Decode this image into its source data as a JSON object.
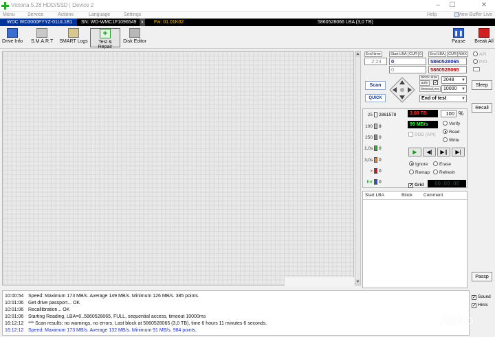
{
  "window": {
    "title": "Victoria 5.28 HDD/SSD | Device 2",
    "controls": [
      "–",
      "☐",
      "✕"
    ]
  },
  "menu": {
    "items": [
      "Menu",
      "Service",
      "Actions",
      "Language",
      "Settings",
      "Help"
    ],
    "view_buffer": "View Buffer Live"
  },
  "drive": {
    "model": "WDC WD3000FYYZ-01UL1B1",
    "serial": "SN: WD-WMC1F1096549",
    "close": "x",
    "firmware": "Fw: 01.01K02",
    "lba": "5860528066 LBA (3,0 TB)"
  },
  "toolbar": {
    "buttons": [
      "Drive Info",
      "S.M.A.R.T",
      "SMART Logs",
      "Test & Repair",
      "Disk Editor"
    ],
    "pause": "Pause",
    "break_all": "Break All"
  },
  "range": {
    "end_time_label": "End time",
    "start_lba_label": "Start LBA",
    "cur_label": "CUR",
    "zero_label": "0",
    "end_lba_label": "End LBA",
    "max_label": "MAX",
    "end_time": "2:24",
    "start_lba": "0",
    "start_lba_cur": "0",
    "end_lba": "5860528065",
    "end_lba_cur": "5860528065"
  },
  "controls": {
    "scan": "Scan",
    "quick": "QUICK",
    "block_size_label": "block size",
    "auto_label": "auto",
    "block_size": "2048",
    "timeout_label": "timeout,ms",
    "timeout": "10000",
    "end_mode": "End of test",
    "api": "API",
    "pio": "PIO",
    "sleep": "Sleep",
    "recall": "Recall",
    "passp": "Passp"
  },
  "stats": {
    "rows": [
      {
        "label": "25",
        "count": "2861578",
        "color": "#ffffff"
      },
      {
        "label": "100",
        "count": "9",
        "color": "#b8b8b8"
      },
      {
        "label": "250",
        "count": "0",
        "color": "#8a8a8a"
      },
      {
        "label": "1,0s",
        "count": "0",
        "color": "#22bb22"
      },
      {
        "label": "3,0s",
        "count": "0",
        "color": "#f08020"
      },
      {
        "label": ">",
        "count": "0",
        "color": "#dd1111"
      },
      {
        "label": "Err",
        "count": "0",
        "color": "#2255dd"
      }
    ],
    "capacity": "3,00 TB",
    "percent": "100",
    "percent_sign": "%",
    "speed": "99 MB/s",
    "ddd_api": "DDD (API)",
    "verify": "Verify",
    "read": "Read",
    "write": "Write",
    "ignore": "Ignore",
    "erase": "Erase",
    "remap": "Remap",
    "refresh": "Refresh",
    "grid": "Grid",
    "timer": "00:00:00",
    "transport": [
      "▶",
      "◀|",
      "▶||",
      "▶|"
    ]
  },
  "log_table": {
    "columns": [
      "Start LBA",
      "Block",
      "Comment"
    ]
  },
  "options": {
    "sound": "Sound",
    "hints": "Hints"
  },
  "log": [
    {
      "time": "10:00:54",
      "text": "Speed: Maximum 173 MB/s. Average 149 MB/s. Minimum 126 MB/s. 385 points.",
      "blue": false
    },
    {
      "time": "10:01:06",
      "text": "Get drive passport... OK",
      "blue": false
    },
    {
      "time": "10:01:06",
      "text": "Recallibration... OK",
      "blue": false
    },
    {
      "time": "10:01:06",
      "text": "Starting Reading, LBA=0..5860528065, FULL, sequential access, timeout 10000ms",
      "blue": false
    },
    {
      "time": "16:12:12",
      "text": "*** Scan results: no warnings, no errors. Last block at 5860528065 (3,0 TB), time 6 hours 11 minutes 6 seconds.",
      "blue": false
    },
    {
      "time": "16:12:12",
      "text": "Speed: Maximum 173 MB/s. Average 132 MB/s. Minimum 91 MB/s. 984 points.",
      "blue": true
    }
  ],
  "watermark": "Avito",
  "colors": {
    "drive_model_bg": "#003399",
    "firmware_text": "#ffcc00",
    "capacity_text": "#ff3333",
    "speed_text": "#33ff33",
    "log_blue": "#1c2fc8"
  }
}
